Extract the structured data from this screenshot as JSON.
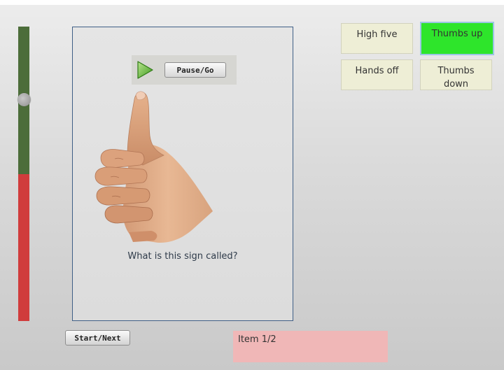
{
  "progress": {
    "fraction_complete": 0.5,
    "fill_color": "#4c6d3a",
    "empty_color": "#d03c3c",
    "knob_position_fraction": 0.25
  },
  "card": {
    "pause_label": "Pause/Go",
    "play_icon": "play-triangle-icon",
    "image_subject": "thumbs-up-hand",
    "question": "What is this sign called?"
  },
  "options": [
    {
      "label": "High five",
      "selected": false
    },
    {
      "label": "Thumbs up",
      "selected": true
    },
    {
      "label": "Hands off",
      "selected": false
    },
    {
      "label": "Thumbs down",
      "selected": false
    }
  ],
  "colors": {
    "selected": "#2ee52b",
    "option_bg": "#eeeed6",
    "status_bg": "#f0b7b7",
    "card_border": "#3f5f86"
  },
  "controls": {
    "start_label": "Start/Next"
  },
  "status": {
    "text": "Item 1/2"
  }
}
